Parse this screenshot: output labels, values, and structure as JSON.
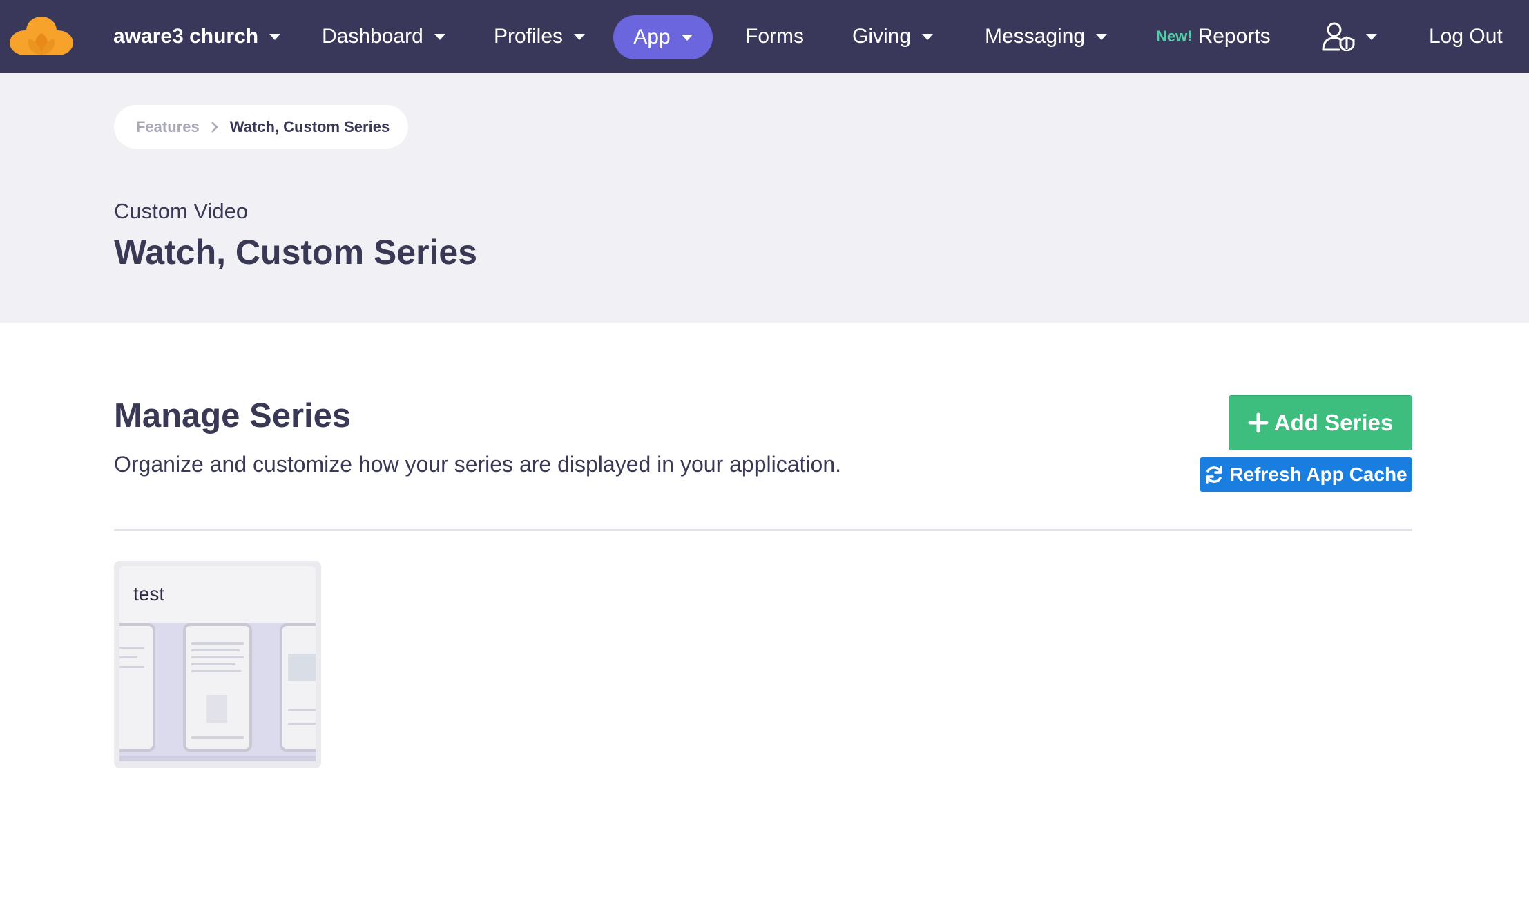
{
  "nav": {
    "org_name": "aware3 church",
    "items": [
      {
        "label": "Dashboard"
      },
      {
        "label": "Profiles"
      },
      {
        "label": "App"
      },
      {
        "label": "Forms"
      },
      {
        "label": "Giving"
      },
      {
        "label": "Messaging"
      }
    ],
    "reports": {
      "new_badge": "New!",
      "label": "Reports"
    },
    "logout_label": "Log Out",
    "active_item": "App",
    "colors": {
      "bar": "#39385a",
      "active_pill": "#6b66dd",
      "new_badge": "#4fd1a8",
      "logo": "#f6a22b"
    }
  },
  "breadcrumb": {
    "items": [
      "Features",
      "Watch, Custom Series"
    ]
  },
  "header": {
    "subtitle": "Custom Video",
    "title": "Watch, Custom Series"
  },
  "main": {
    "section_title": "Manage Series",
    "section_description": "Organize and customize how your series are displayed in your application.",
    "add_button": {
      "label": "Add Series",
      "icon": "plus-icon",
      "color": "#3dbe7e"
    },
    "refresh_button": {
      "label": "Refresh App Cache",
      "icon": "refresh-icon",
      "color": "#1a7ee0"
    }
  },
  "series": [
    {
      "title": "test"
    }
  ]
}
